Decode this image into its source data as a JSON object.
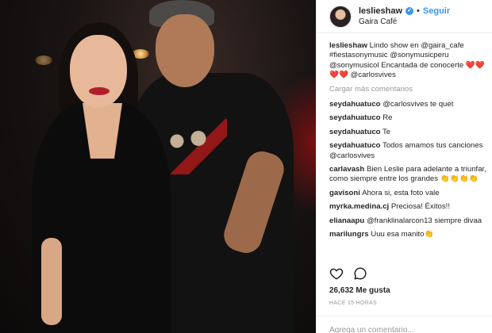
{
  "post": {
    "header": {
      "username": "leslieshaw",
      "verified_mark": "✔",
      "separator": "•",
      "follow_label": "Seguir",
      "location": "Gaira Café"
    },
    "caption": {
      "username": "leslieshaw",
      "text": "Lindo show en @gaira_cafe #fiestasonymusic @sonymusicperu @sonymusicol Encantada de conocerte ❤️❤️❤️❤️ @carlosvives"
    },
    "load_more": "Cargar más comentarios",
    "comments": [
      {
        "user": "seydahuatuco",
        "text": "@carlosvives te quet"
      },
      {
        "user": "seydahuatuco",
        "text": "Re"
      },
      {
        "user": "seydahuatuco",
        "text": "Te"
      },
      {
        "user": "seydahuatuco",
        "text": "Todos amamos tus canciones @carlosvives"
      },
      {
        "user": "carlavash",
        "text": "Bien Leslie para adelante a triunfar, como siempre entre los grandes 👏👏👏👏"
      },
      {
        "user": "gavisoni",
        "text": "Ahora si, esta foto vale"
      },
      {
        "user": "myrka.medina.cj",
        "text": "Preciosa! Éxitos!!"
      },
      {
        "user": "elianaapu",
        "text": "@franklinalarcon13 siempre divaa"
      },
      {
        "user": "marilungrs",
        "text": "Uuu esa manito👏"
      }
    ],
    "likes": "26,632 Me gusta",
    "time": "HACE 15 HORAS",
    "add_comment_placeholder": "Agrega un comentario..."
  },
  "icons": {
    "like": "heart-icon",
    "comment": "comment-icon",
    "verified": "verified-badge-icon"
  },
  "colors": {
    "link": "#003569",
    "follow": "#3897f0",
    "muted": "#999999"
  }
}
